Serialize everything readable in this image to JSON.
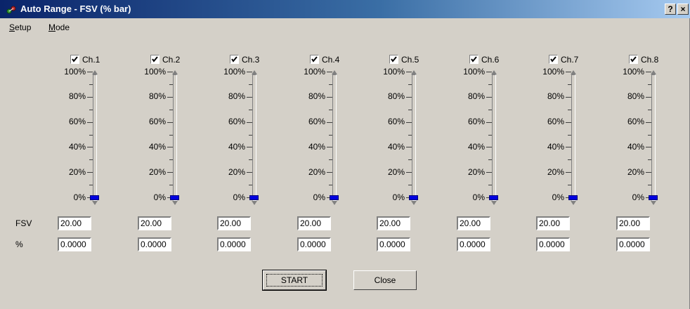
{
  "window": {
    "title": "Auto Range - FSV (% bar)",
    "help_label": "?",
    "close_label": "×"
  },
  "menu": [
    {
      "underline": "S",
      "rest": "etup"
    },
    {
      "underline": "M",
      "rest": "ode"
    }
  ],
  "ticks": [
    "100%",
    "80%",
    "60%",
    "40%",
    "20%",
    "0%"
  ],
  "row_labels": {
    "fsv": "FSV",
    "percent": "%"
  },
  "channels": [
    {
      "label": "Ch.1",
      "checked": true,
      "fsv": "20.00",
      "percent": "0.0000",
      "slider_value": 0
    },
    {
      "label": "Ch.2",
      "checked": true,
      "fsv": "20.00",
      "percent": "0.0000",
      "slider_value": 0
    },
    {
      "label": "Ch.3",
      "checked": true,
      "fsv": "20.00",
      "percent": "0.0000",
      "slider_value": 0
    },
    {
      "label": "Ch.4",
      "checked": true,
      "fsv": "20.00",
      "percent": "0.0000",
      "slider_value": 0
    },
    {
      "label": "Ch.5",
      "checked": true,
      "fsv": "20.00",
      "percent": "0.0000",
      "slider_value": 0
    },
    {
      "label": "Ch.6",
      "checked": true,
      "fsv": "20.00",
      "percent": "0.0000",
      "slider_value": 0
    },
    {
      "label": "Ch.7",
      "checked": true,
      "fsv": "20.00",
      "percent": "0.0000",
      "slider_value": 0
    },
    {
      "label": "Ch.8",
      "checked": true,
      "fsv": "20.00",
      "percent": "0.0000",
      "slider_value": 0
    }
  ],
  "buttons": {
    "start": "START",
    "close": "Close"
  }
}
